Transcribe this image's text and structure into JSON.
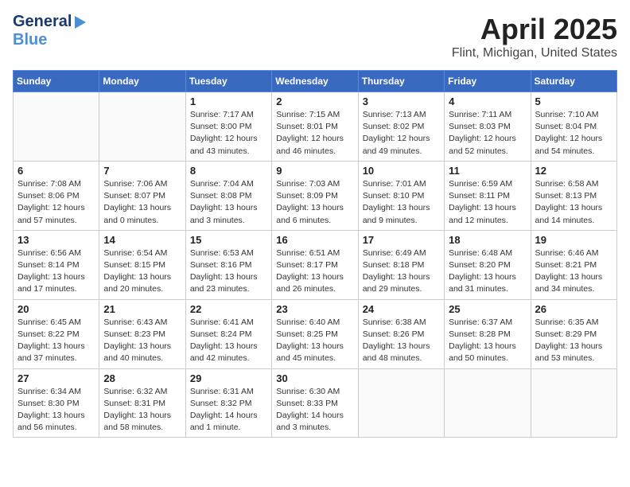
{
  "logo": {
    "line1": "General",
    "line2": "Blue"
  },
  "title": "April 2025",
  "subtitle": "Flint, Michigan, United States",
  "weekdays": [
    "Sunday",
    "Monday",
    "Tuesday",
    "Wednesday",
    "Thursday",
    "Friday",
    "Saturday"
  ],
  "weeks": [
    [
      {
        "day": "",
        "info": ""
      },
      {
        "day": "",
        "info": ""
      },
      {
        "day": "1",
        "info": "Sunrise: 7:17 AM\nSunset: 8:00 PM\nDaylight: 12 hours\nand 43 minutes."
      },
      {
        "day": "2",
        "info": "Sunrise: 7:15 AM\nSunset: 8:01 PM\nDaylight: 12 hours\nand 46 minutes."
      },
      {
        "day": "3",
        "info": "Sunrise: 7:13 AM\nSunset: 8:02 PM\nDaylight: 12 hours\nand 49 minutes."
      },
      {
        "day": "4",
        "info": "Sunrise: 7:11 AM\nSunset: 8:03 PM\nDaylight: 12 hours\nand 52 minutes."
      },
      {
        "day": "5",
        "info": "Sunrise: 7:10 AM\nSunset: 8:04 PM\nDaylight: 12 hours\nand 54 minutes."
      }
    ],
    [
      {
        "day": "6",
        "info": "Sunrise: 7:08 AM\nSunset: 8:06 PM\nDaylight: 12 hours\nand 57 minutes."
      },
      {
        "day": "7",
        "info": "Sunrise: 7:06 AM\nSunset: 8:07 PM\nDaylight: 13 hours\nand 0 minutes."
      },
      {
        "day": "8",
        "info": "Sunrise: 7:04 AM\nSunset: 8:08 PM\nDaylight: 13 hours\nand 3 minutes."
      },
      {
        "day": "9",
        "info": "Sunrise: 7:03 AM\nSunset: 8:09 PM\nDaylight: 13 hours\nand 6 minutes."
      },
      {
        "day": "10",
        "info": "Sunrise: 7:01 AM\nSunset: 8:10 PM\nDaylight: 13 hours\nand 9 minutes."
      },
      {
        "day": "11",
        "info": "Sunrise: 6:59 AM\nSunset: 8:11 PM\nDaylight: 13 hours\nand 12 minutes."
      },
      {
        "day": "12",
        "info": "Sunrise: 6:58 AM\nSunset: 8:13 PM\nDaylight: 13 hours\nand 14 minutes."
      }
    ],
    [
      {
        "day": "13",
        "info": "Sunrise: 6:56 AM\nSunset: 8:14 PM\nDaylight: 13 hours\nand 17 minutes."
      },
      {
        "day": "14",
        "info": "Sunrise: 6:54 AM\nSunset: 8:15 PM\nDaylight: 13 hours\nand 20 minutes."
      },
      {
        "day": "15",
        "info": "Sunrise: 6:53 AM\nSunset: 8:16 PM\nDaylight: 13 hours\nand 23 minutes."
      },
      {
        "day": "16",
        "info": "Sunrise: 6:51 AM\nSunset: 8:17 PM\nDaylight: 13 hours\nand 26 minutes."
      },
      {
        "day": "17",
        "info": "Sunrise: 6:49 AM\nSunset: 8:18 PM\nDaylight: 13 hours\nand 29 minutes."
      },
      {
        "day": "18",
        "info": "Sunrise: 6:48 AM\nSunset: 8:20 PM\nDaylight: 13 hours\nand 31 minutes."
      },
      {
        "day": "19",
        "info": "Sunrise: 6:46 AM\nSunset: 8:21 PM\nDaylight: 13 hours\nand 34 minutes."
      }
    ],
    [
      {
        "day": "20",
        "info": "Sunrise: 6:45 AM\nSunset: 8:22 PM\nDaylight: 13 hours\nand 37 minutes."
      },
      {
        "day": "21",
        "info": "Sunrise: 6:43 AM\nSunset: 8:23 PM\nDaylight: 13 hours\nand 40 minutes."
      },
      {
        "day": "22",
        "info": "Sunrise: 6:41 AM\nSunset: 8:24 PM\nDaylight: 13 hours\nand 42 minutes."
      },
      {
        "day": "23",
        "info": "Sunrise: 6:40 AM\nSunset: 8:25 PM\nDaylight: 13 hours\nand 45 minutes."
      },
      {
        "day": "24",
        "info": "Sunrise: 6:38 AM\nSunset: 8:26 PM\nDaylight: 13 hours\nand 48 minutes."
      },
      {
        "day": "25",
        "info": "Sunrise: 6:37 AM\nSunset: 8:28 PM\nDaylight: 13 hours\nand 50 minutes."
      },
      {
        "day": "26",
        "info": "Sunrise: 6:35 AM\nSunset: 8:29 PM\nDaylight: 13 hours\nand 53 minutes."
      }
    ],
    [
      {
        "day": "27",
        "info": "Sunrise: 6:34 AM\nSunset: 8:30 PM\nDaylight: 13 hours\nand 56 minutes."
      },
      {
        "day": "28",
        "info": "Sunrise: 6:32 AM\nSunset: 8:31 PM\nDaylight: 13 hours\nand 58 minutes."
      },
      {
        "day": "29",
        "info": "Sunrise: 6:31 AM\nSunset: 8:32 PM\nDaylight: 14 hours\nand 1 minute."
      },
      {
        "day": "30",
        "info": "Sunrise: 6:30 AM\nSunset: 8:33 PM\nDaylight: 14 hours\nand 3 minutes."
      },
      {
        "day": "",
        "info": ""
      },
      {
        "day": "",
        "info": ""
      },
      {
        "day": "",
        "info": ""
      }
    ]
  ]
}
